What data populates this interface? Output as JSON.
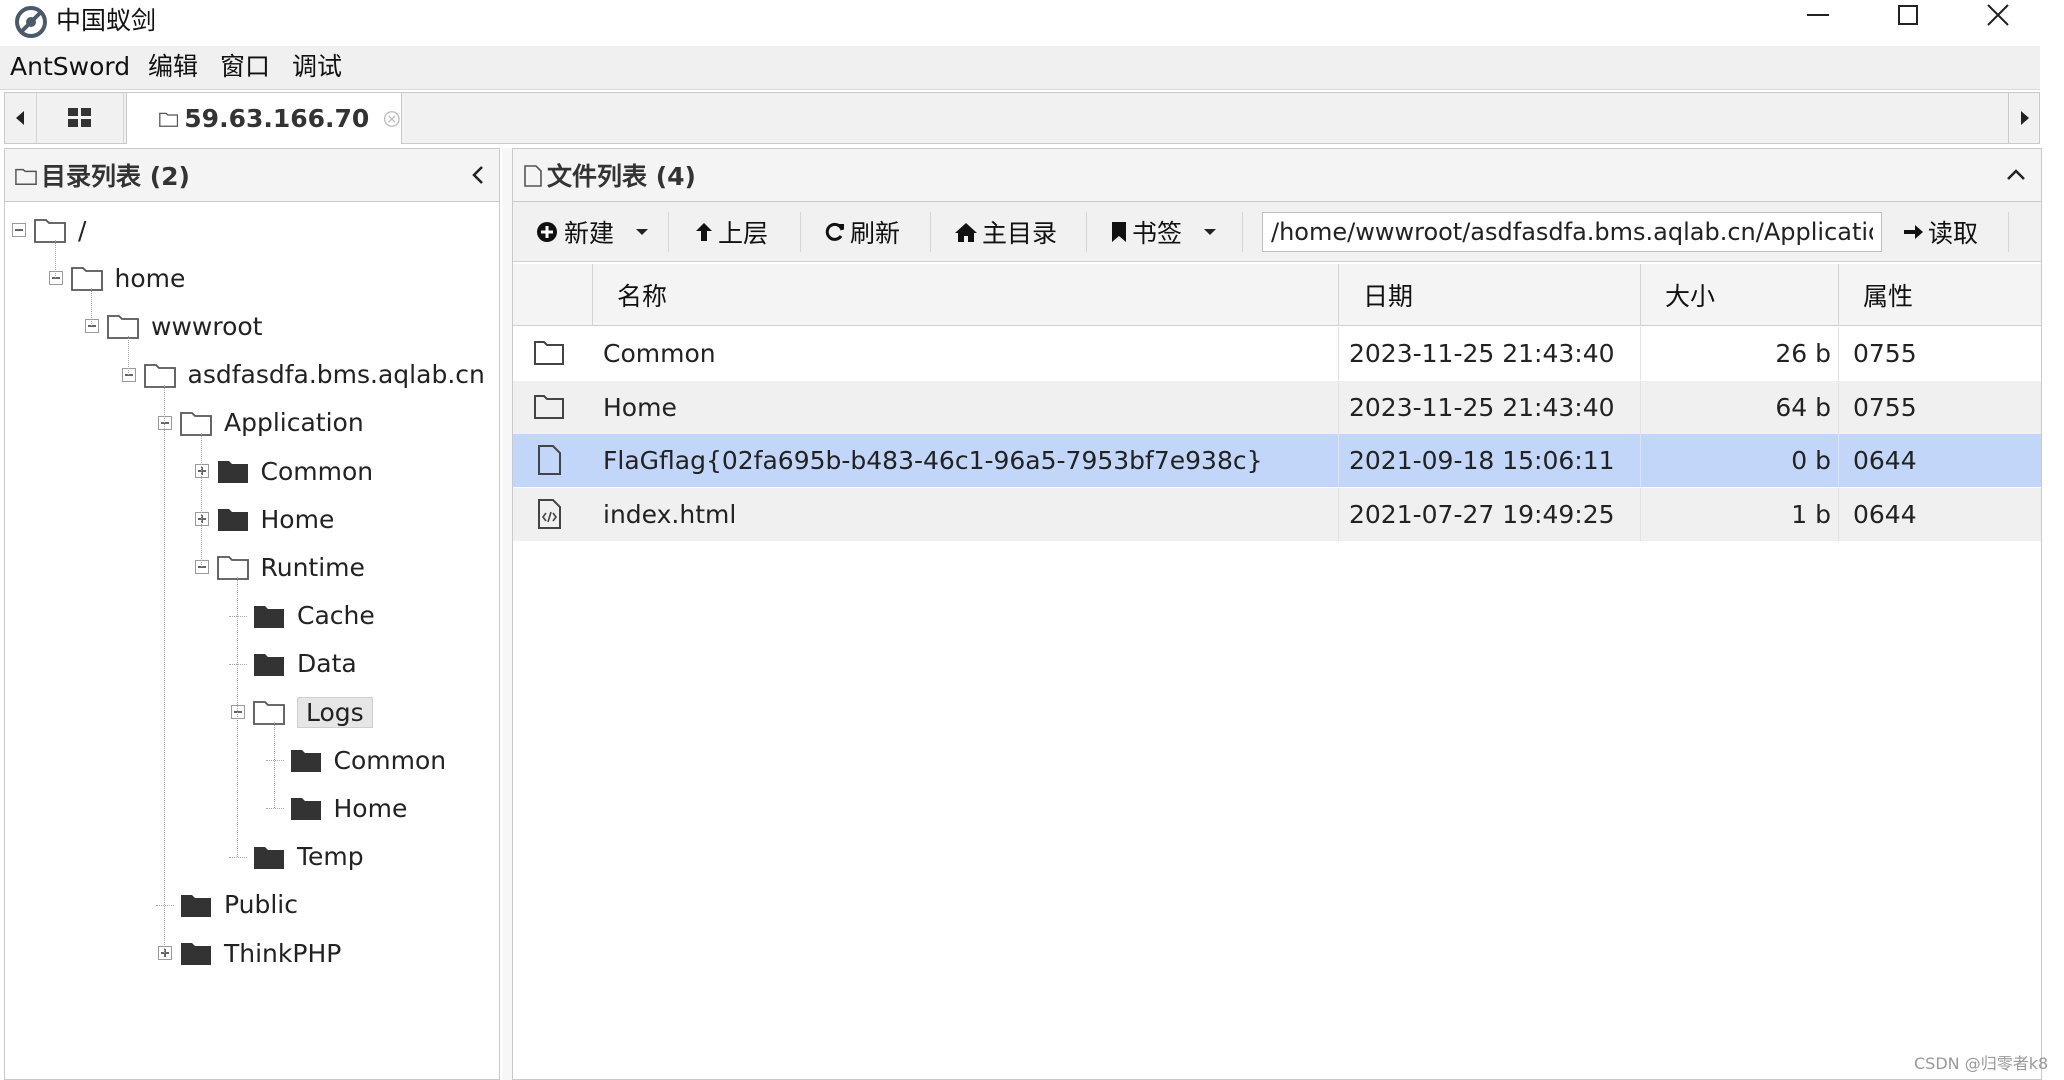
{
  "window": {
    "title": "中国蚁剑"
  },
  "menu": {
    "items": [
      "AntSword",
      "编辑",
      "窗口",
      "调试"
    ]
  },
  "tabs": {
    "host_label": "59.63.166.70"
  },
  "left_panel": {
    "title": "目录列表 (2)",
    "tree": [
      {
        "label": "/",
        "toggle": "minus",
        "icon": "outline"
      },
      {
        "label": "home",
        "toggle": "minus",
        "icon": "outline"
      },
      {
        "label": "wwwroot",
        "toggle": "minus",
        "icon": "outline"
      },
      {
        "label": "asdfasdfa.bms.aqlab.cn",
        "toggle": "minus",
        "icon": "outline"
      },
      {
        "label": "Application",
        "toggle": "minus",
        "icon": "outline"
      },
      {
        "label": "Common",
        "toggle": "plus",
        "icon": "filled"
      },
      {
        "label": "Home",
        "toggle": "plus",
        "icon": "filled"
      },
      {
        "label": "Runtime",
        "toggle": "minus",
        "icon": "outline"
      },
      {
        "label": "Cache",
        "toggle": "none",
        "icon": "filled"
      },
      {
        "label": "Data",
        "toggle": "none",
        "icon": "filled"
      },
      {
        "label": "Logs",
        "toggle": "minus",
        "icon": "outline",
        "selected": true
      },
      {
        "label": "Common",
        "toggle": "none",
        "icon": "filled"
      },
      {
        "label": "Home",
        "toggle": "none",
        "icon": "filled"
      },
      {
        "label": "Temp",
        "toggle": "none",
        "icon": "filled"
      },
      {
        "label": "Public",
        "toggle": "none",
        "icon": "filled"
      },
      {
        "label": "ThinkPHP",
        "toggle": "plus",
        "icon": "filled"
      }
    ]
  },
  "right_panel": {
    "title": "文件列表 (4)",
    "toolbar": {
      "new_label": "新建",
      "up_label": "上层",
      "refresh_label": "刷新",
      "home_label": "主目录",
      "bookmark_label": "书签",
      "path_value": "/home/wwwroot/asdfasdfa.bms.aqlab.cn/Application/Runtime/Logs/",
      "read_label": "读取"
    },
    "columns": [
      "名称",
      "日期",
      "大小",
      "属性"
    ],
    "rows": [
      {
        "icon": "folder-icon",
        "name": "Common",
        "date": "2023-11-25 21:43:40",
        "size": "26 b",
        "perm": "0755"
      },
      {
        "icon": "folder-icon",
        "name": "Home",
        "date": "2023-11-25 21:43:40",
        "size": "64 b",
        "perm": "0755"
      },
      {
        "icon": "file-icon",
        "name": "FlaGflag{02fa695b-b483-46c1-96a5-7953bf7e938c}",
        "date": "2021-09-18 15:06:11",
        "size": "0 b",
        "perm": "0644",
        "selected": true
      },
      {
        "icon": "code-file-icon",
        "name": "index.html",
        "date": "2021-07-27 19:49:25",
        "size": "1 b",
        "perm": "0644"
      }
    ]
  },
  "watermark": "CSDN @归零者k8"
}
